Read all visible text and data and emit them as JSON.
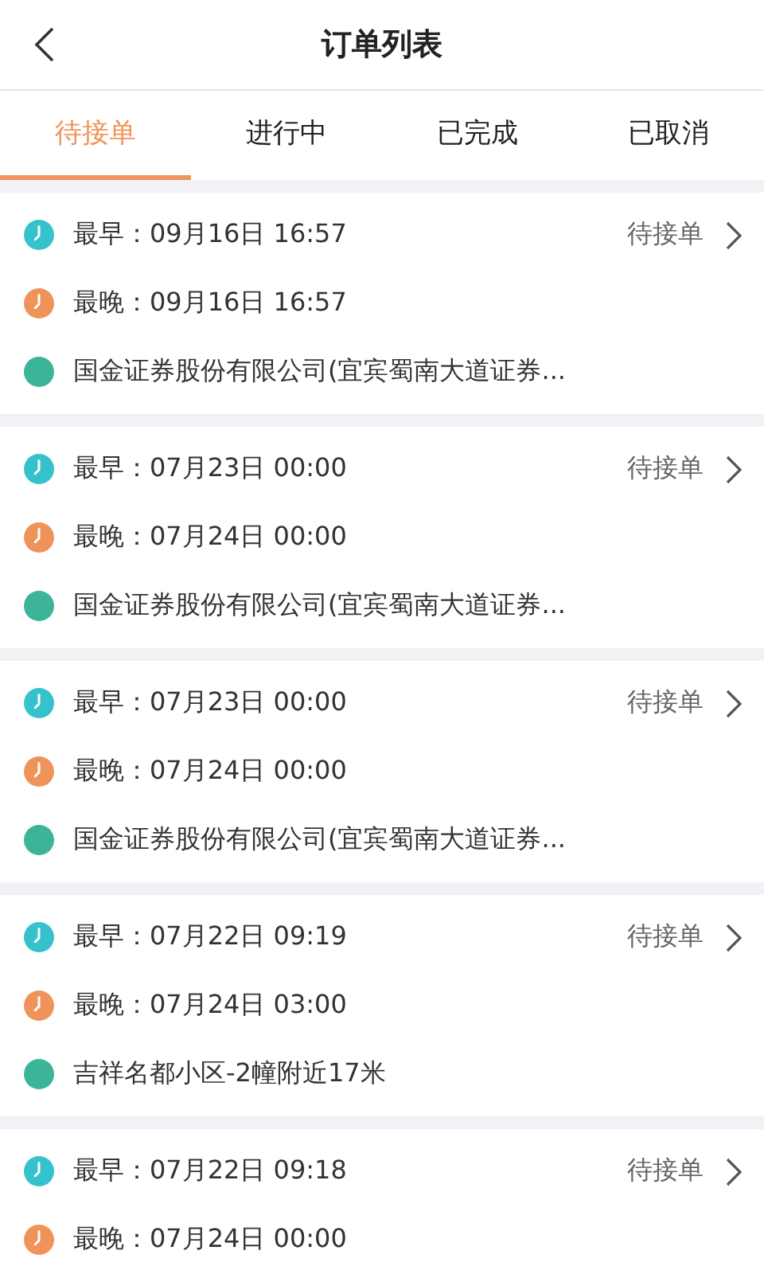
{
  "header": {
    "title": "订单列表"
  },
  "tabs": [
    {
      "label": "待接单",
      "selected": true
    },
    {
      "label": "进行中",
      "selected": false
    },
    {
      "label": "已完成",
      "selected": false
    },
    {
      "label": "已取消",
      "selected": false
    }
  ],
  "orders": [
    {
      "earliest": "最早：09月16日 16:57",
      "latest": "最晚：09月16日 16:57",
      "status": "待接单",
      "place": "国金证券股份有限公司(宜宾蜀南大道证券..."
    },
    {
      "earliest": "最早：07月23日 00:00",
      "latest": "最晚：07月24日 00:00",
      "status": "待接单",
      "place": "国金证券股份有限公司(宜宾蜀南大道证券..."
    },
    {
      "earliest": "最早：07月23日 00:00",
      "latest": "最晚：07月24日 00:00",
      "status": "待接单",
      "place": "国金证券股份有限公司(宜宾蜀南大道证券..."
    },
    {
      "earliest": "最早：07月22日 09:19",
      "latest": "最晚：07月24日 03:00",
      "status": "待接单",
      "place": "吉祥名都小区-2幢附近17米"
    },
    {
      "earliest": "最早：07月22日 09:18",
      "latest": "最晚：07月24日 00:00",
      "status": "待接单"
    }
  ]
}
